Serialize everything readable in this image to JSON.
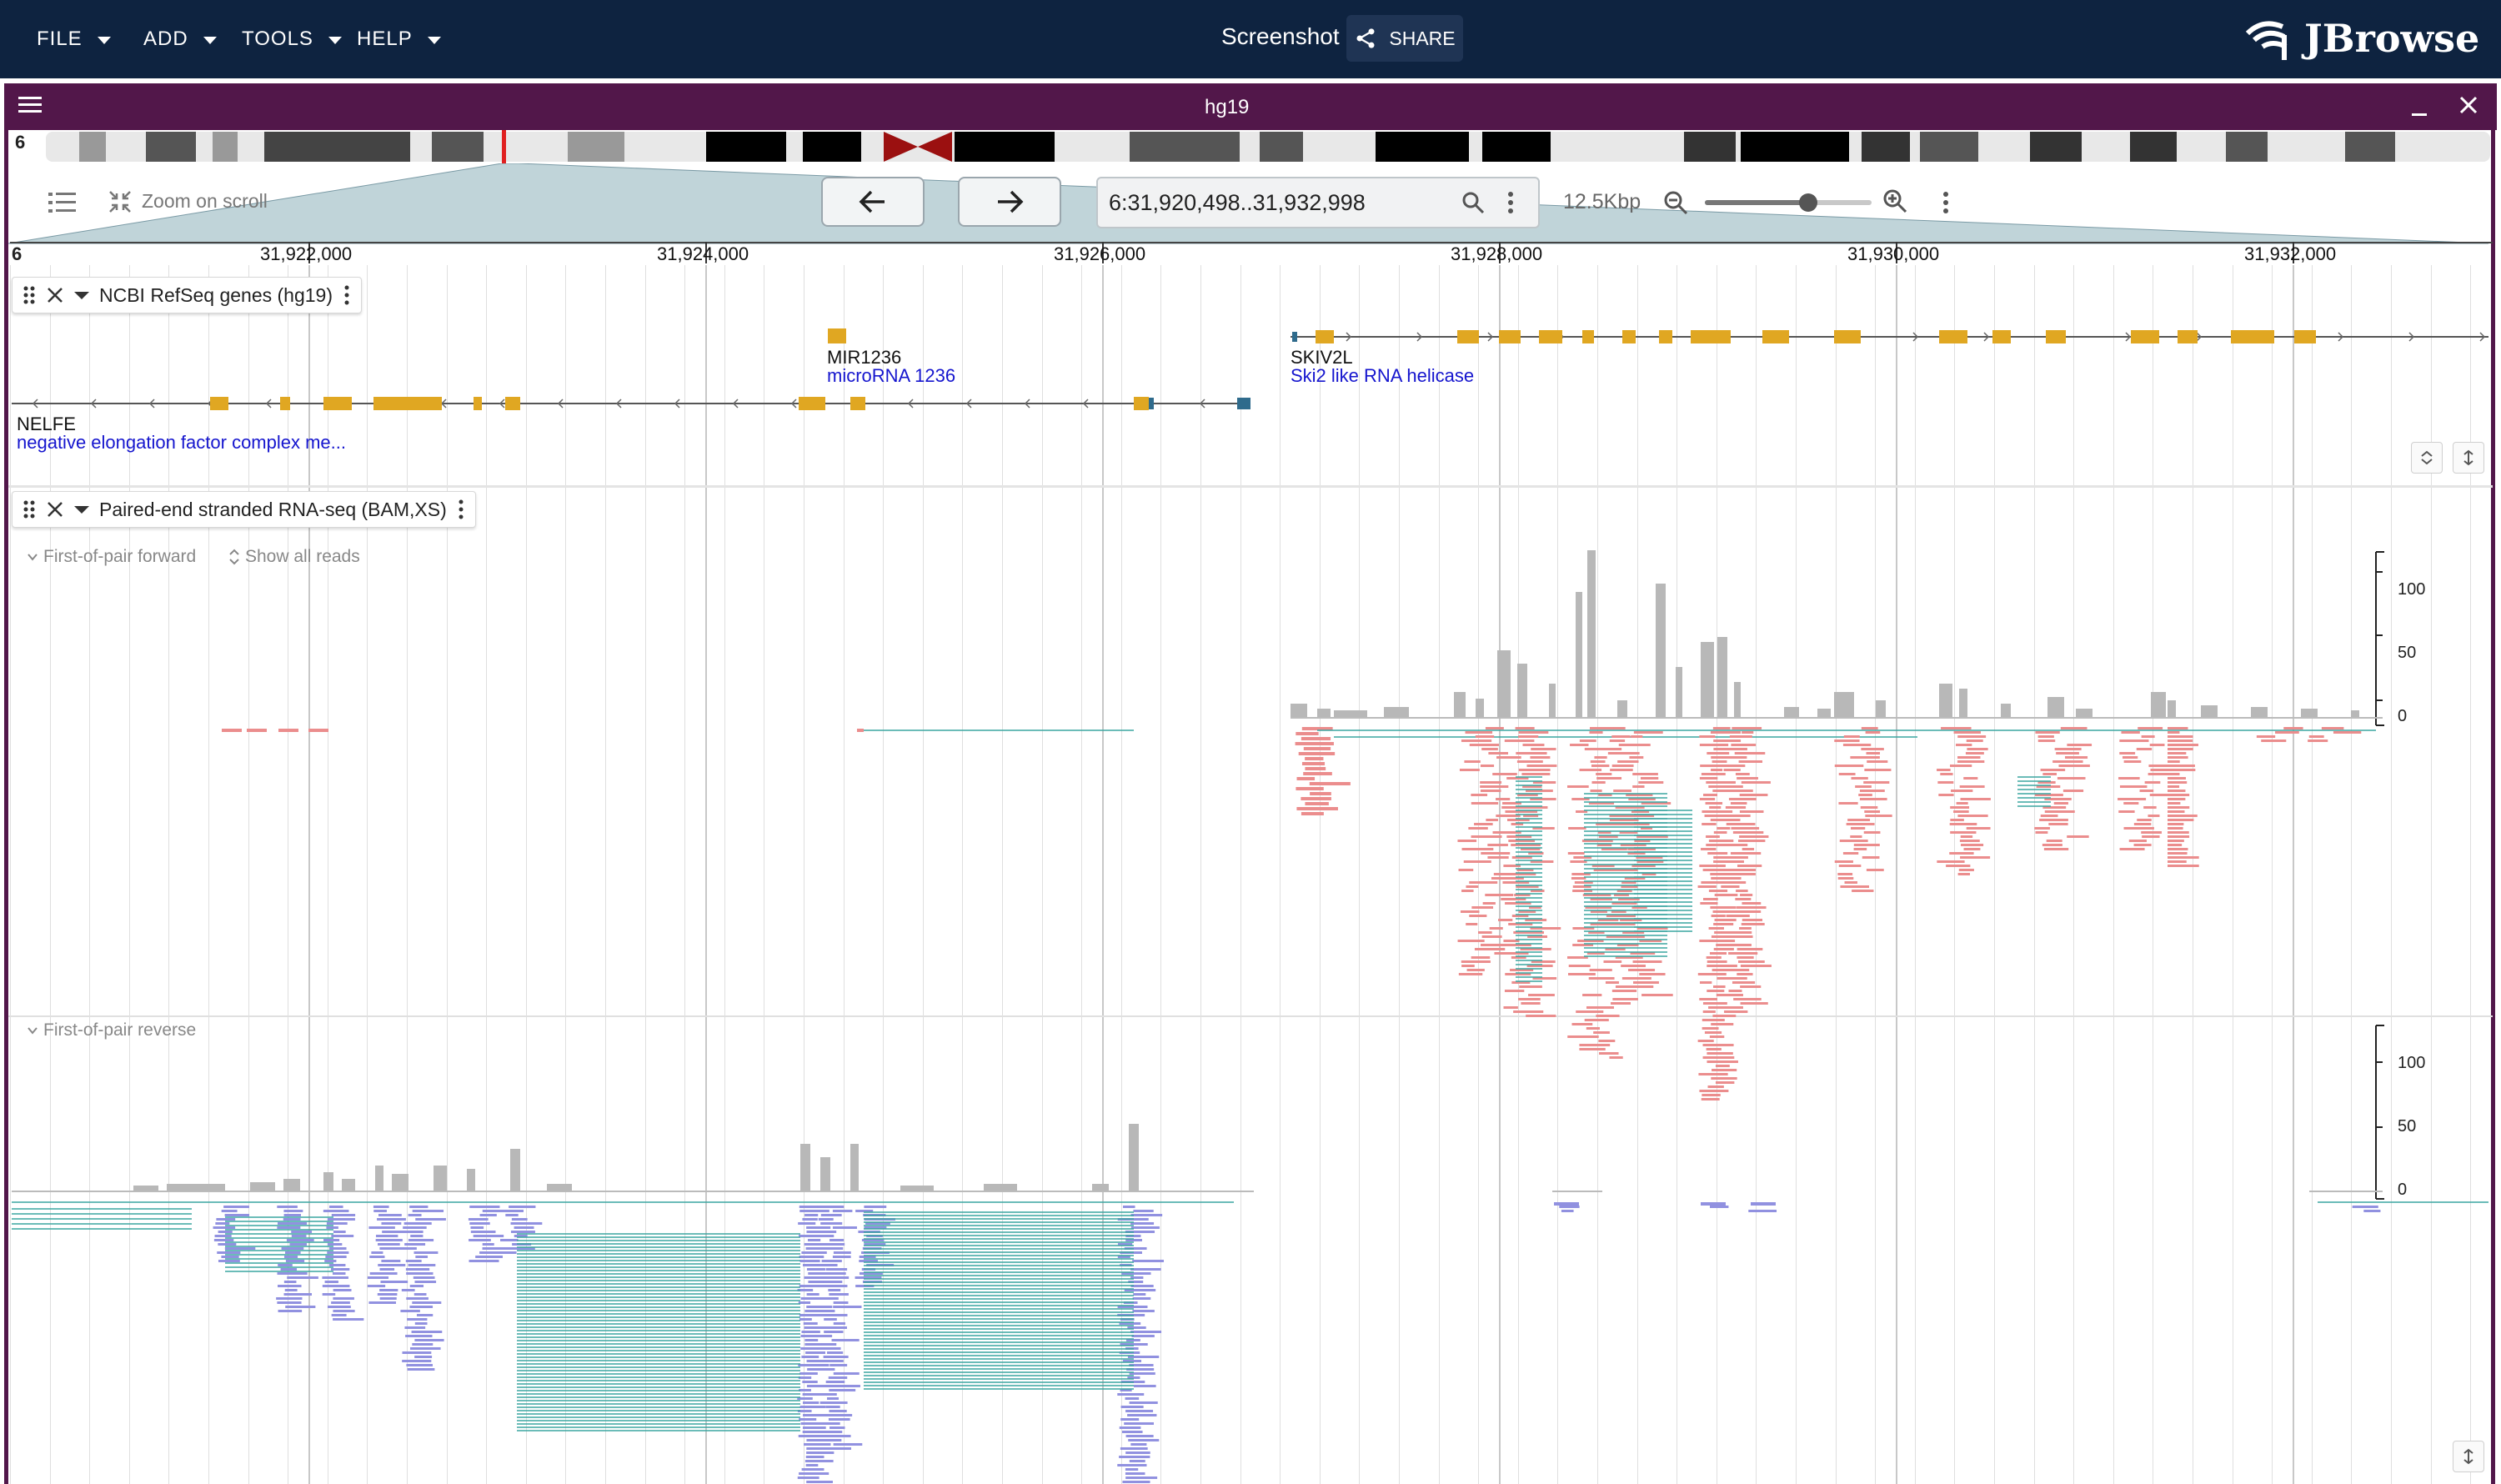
{
  "app": {
    "menus": [
      "FILE",
      "ADD",
      "TOOLS",
      "HELP"
    ],
    "session_name": "Screenshot",
    "share_label": "SHARE",
    "logo_text": "JBrowse"
  },
  "view": {
    "title": "hg19",
    "chromosome": "6",
    "location": "6:31,920,498..31,932,998",
    "span": "12.5Kbp",
    "zoom_on_scroll_label": "Zoom on scroll",
    "zoom_level": 0.62
  },
  "ruler": {
    "ticks": [
      "31,922,000",
      "31,924,000",
      "31,926,000",
      "31,928,000",
      "31,930,000",
      "31,932,000"
    ]
  },
  "tracks": {
    "refseq": {
      "label": "NCBI RefSeq genes (hg19)",
      "genes": [
        {
          "name": "NELFE",
          "description": "negative elongation factor complex me..."
        },
        {
          "name": "MIR1236",
          "description": "microRNA 1236"
        },
        {
          "name": "SKIV2L",
          "description": "Ski2 like RNA helicase"
        }
      ]
    },
    "rnaseq": {
      "label": "Paired-end stranded RNA-seq (BAM,XS)",
      "forward_label": "First-of-pair forward",
      "show_all_label": "Show all reads",
      "reverse_label": "First-of-pair reverse",
      "coverage_axis": [
        "100",
        "50",
        "0"
      ]
    }
  },
  "colors": {
    "appbar": "#0e2340",
    "view_header": "#52174a",
    "exon": "#e0a722",
    "gene_desc": "#1515ce",
    "forward_read": "#eb8d8d",
    "reverse_read": "#9191e0",
    "coverage": "#b8b8b8",
    "junction": "#3aa5a0"
  }
}
